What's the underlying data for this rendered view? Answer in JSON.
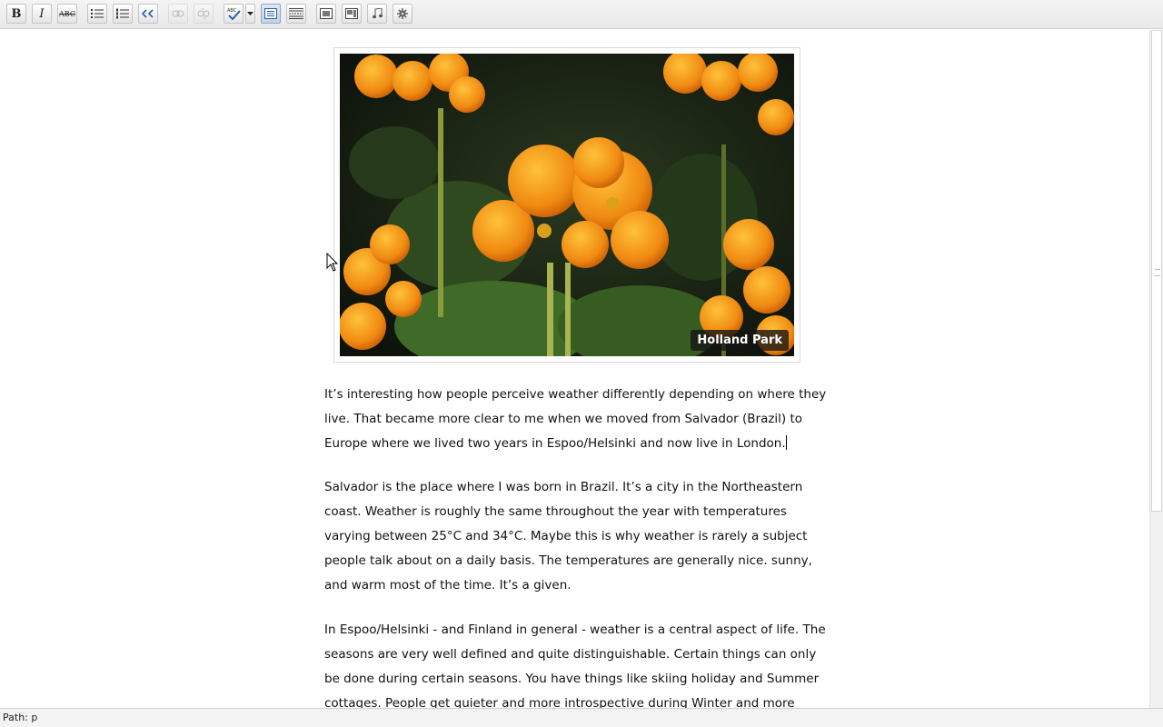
{
  "toolbar": {
    "buttons": [
      {
        "name": "bold-button",
        "label": "B"
      },
      {
        "name": "italic-button",
        "label": "I"
      },
      {
        "name": "strikethrough-button",
        "label": "ABC"
      },
      {
        "name": "bullet-list-button",
        "icon": "bullet-list-icon"
      },
      {
        "name": "numbered-list-button",
        "icon": "numbered-list-icon"
      },
      {
        "name": "blockquote-button",
        "icon": "quote-icon"
      },
      {
        "name": "insert-link-button",
        "icon": "link-icon",
        "disabled": true
      },
      {
        "name": "remove-link-button",
        "icon": "unlink-icon",
        "disabled": true
      },
      {
        "name": "spellcheck-button",
        "label": "ABC",
        "icon": "spellcheck-icon"
      },
      {
        "name": "toggle-toolbar-button",
        "icon": "kitchen-sink-icon",
        "active": true
      },
      {
        "name": "insert-more-button",
        "icon": "read-more-icon"
      },
      {
        "name": "add-image-button",
        "icon": "image-icon"
      },
      {
        "name": "add-video-button",
        "icon": "video-icon"
      },
      {
        "name": "add-audio-button",
        "icon": "music-icon"
      },
      {
        "name": "add-media-button",
        "icon": "gear-icon"
      }
    ]
  },
  "content": {
    "image_caption": "Holland Park",
    "paragraphs": [
      "It’s interesting how people perceive weather differently depending on where they live. That became more clear to me when we moved from Salvador (Brazil) to Europe where we lived two years in Espoo/Helsinki and now live in London.",
      "Salvador is the place where I was born in Brazil. It’s a city in the Northeastern coast. Weather is roughly the same throughout the year with temperatures varying between 25°C and 34°C. Maybe this is why weather is rarely a subject people talk about on a daily basis. The temperatures are generally nice. sunny, and warm most of the time. It’s a given.",
      "In Espoo/Helsinki - and Finland in general - weather is a central aspect of life. The seasons are very well defined and quite distinguishable. Certain things can only be done during certain seasons. You have things like skiing holiday and Summer cottages. People get quieter and more introspective during Winter and more lively"
    ]
  },
  "statusbar": {
    "path": "Path: p"
  }
}
